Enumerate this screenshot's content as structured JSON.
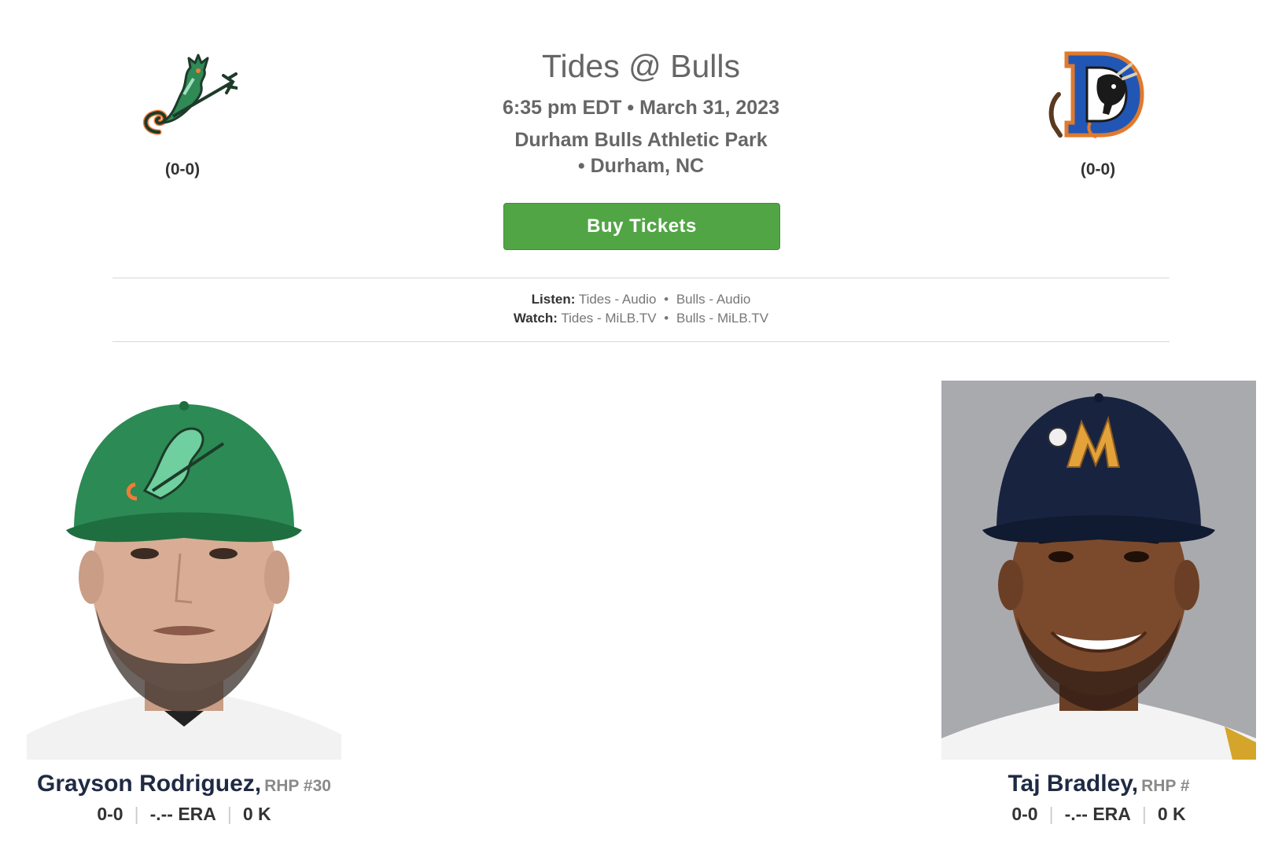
{
  "game": {
    "title": "Tides @ Bulls",
    "datetime": "6:35 pm EDT • March 31, 2023",
    "venue_line1": "Durham Bulls Athletic Park",
    "venue_line2": "• Durham, NC",
    "buy_label": "Buy Tickets"
  },
  "away_team": {
    "name": "Tides",
    "record": "(0-0)",
    "logo_icon": "seahorse-trident-logo-icon"
  },
  "home_team": {
    "name": "Bulls",
    "record": "(0-0)",
    "logo_icon": "bull-d-logo-icon"
  },
  "media": {
    "listen_label": "Listen:",
    "listen_links": [
      "Tides - Audio",
      "Bulls - Audio"
    ],
    "watch_label": "Watch:",
    "watch_links": [
      "Tides - MiLB.TV",
      "Bulls - MiLB.TV"
    ],
    "separator": "•"
  },
  "pitchers": {
    "away": {
      "name": "Grayson Rodriguez,",
      "position": "RHP #30",
      "record": "0-0",
      "era": "-.-- ERA",
      "strikeouts": "0 K"
    },
    "home": {
      "name": "Taj Bradley,",
      "position": "RHP #",
      "record": "0-0",
      "era": "-.-- ERA",
      "strikeouts": "0 K"
    }
  },
  "colors": {
    "buy_button": "#51a545",
    "pitcher_name": "#1f2a44",
    "home_headshot_bg": "#a9aaae"
  }
}
